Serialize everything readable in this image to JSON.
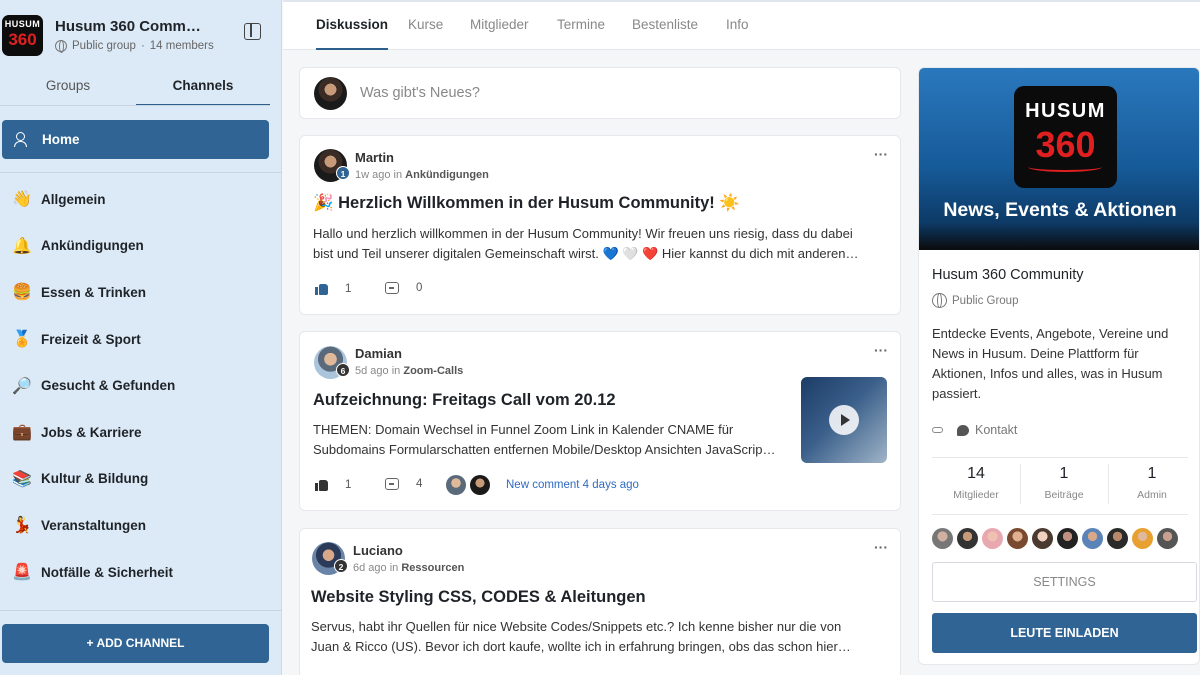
{
  "group": {
    "logo_line1": "HUSUM",
    "logo_line2": "360",
    "title": "Husum 360 Comm…",
    "visibility": "Public group",
    "members": "14 members"
  },
  "sidebar": {
    "tabs": [
      "Groups",
      "Channels"
    ],
    "active_tab": "Channels",
    "home_label": "Home",
    "channels": [
      {
        "emoji": "👋",
        "label": "Allgemein"
      },
      {
        "emoji": "🔔",
        "label": "Ankündigungen"
      },
      {
        "emoji": "🍔",
        "label": "Essen & Trinken"
      },
      {
        "emoji": "🏅",
        "label": "Freizeit & Sport"
      },
      {
        "emoji": "🔎",
        "label": "Gesucht & Gefunden"
      },
      {
        "emoji": "💼",
        "label": "Jobs & Karriere"
      },
      {
        "emoji": "📚",
        "label": "Kultur & Bildung"
      },
      {
        "emoji": "💃",
        "label": "Veranstaltungen"
      },
      {
        "emoji": "🚨",
        "label": "Notfälle & Sicherheit"
      }
    ],
    "add_channel": "+ ADD CHANNEL"
  },
  "topnav": {
    "tabs": [
      "Diskussion",
      "Kurse",
      "Mitglieder",
      "Termine",
      "Bestenliste",
      "Info"
    ],
    "active": "Diskussion"
  },
  "composer": {
    "placeholder": "Was gibt's Neues?"
  },
  "posts": [
    {
      "author": "Martin",
      "level": "1",
      "time": "1w ago",
      "in_word": "in",
      "channel": "Ankündigungen",
      "title": "🎉 Herzlich Willkommen in der Husum Community! ☀️",
      "body_line1": "Hallo und herzlich willkommen in der Husum Community! Wir freuen uns riesig, dass du dabei",
      "body_line2": "bist und Teil unserer digitalen Gemeinschaft wirst. 💙 🤍 ❤️  Hier kannst du dich mit anderen…",
      "likes": "1",
      "comments": "0"
    },
    {
      "author": "Damian",
      "level": "6",
      "time": "5d ago",
      "in_word": "in",
      "channel": "Zoom-Calls",
      "title": "Aufzeichnung: Freitags Call vom 20.12",
      "body_line1": "THEMEN: Domain Wechsel in Funnel Zoom Link in Kalender CNAME für",
      "body_line2": "Subdomains Formularschatten entfernen Mobile/Desktop Ansichten JavaScrip…",
      "likes": "1",
      "comments": "4",
      "new_comment": "New comment 4 days ago"
    },
    {
      "author": "Luciano",
      "level": "2",
      "time": "6d ago",
      "in_word": "in",
      "channel": "Ressourcen",
      "title": "Website Styling CSS, CODES & Aleitungen",
      "body_line1": "Servus, habt ihr Quellen für nice Website Codes/Snippets etc.? Ich kenne bisher nur die von",
      "body_line2": "Juan & Ricco (US). Bevor ich dort kaufe, wollte ich in erfahrung bringen, obs das schon hier…"
    }
  ],
  "about": {
    "banner_logo1": "HUSUM",
    "banner_logo2": "360",
    "banner_text": "News, Events & Aktionen",
    "title": "Husum 360 Community",
    "type": "Public Group",
    "description": "Entdecke Events, Angebote, Vereine und News in Husum. Deine Plattform für Aktionen, Infos und alles, was in Husum passiert.",
    "contact": "Kontakt",
    "stats": [
      {
        "num": "14",
        "label": "Mitglieder"
      },
      {
        "num": "1",
        "label": "Beiträge"
      },
      {
        "num": "1",
        "label": "Admin"
      }
    ],
    "settings": "SETTINGS",
    "invite": "LEUTE EINLADEN"
  },
  "colors": {
    "accent": "#2f6494",
    "sidebar_bg": "#dceaf7",
    "link": "#2e6cc0",
    "logo_red": "#e02020"
  }
}
